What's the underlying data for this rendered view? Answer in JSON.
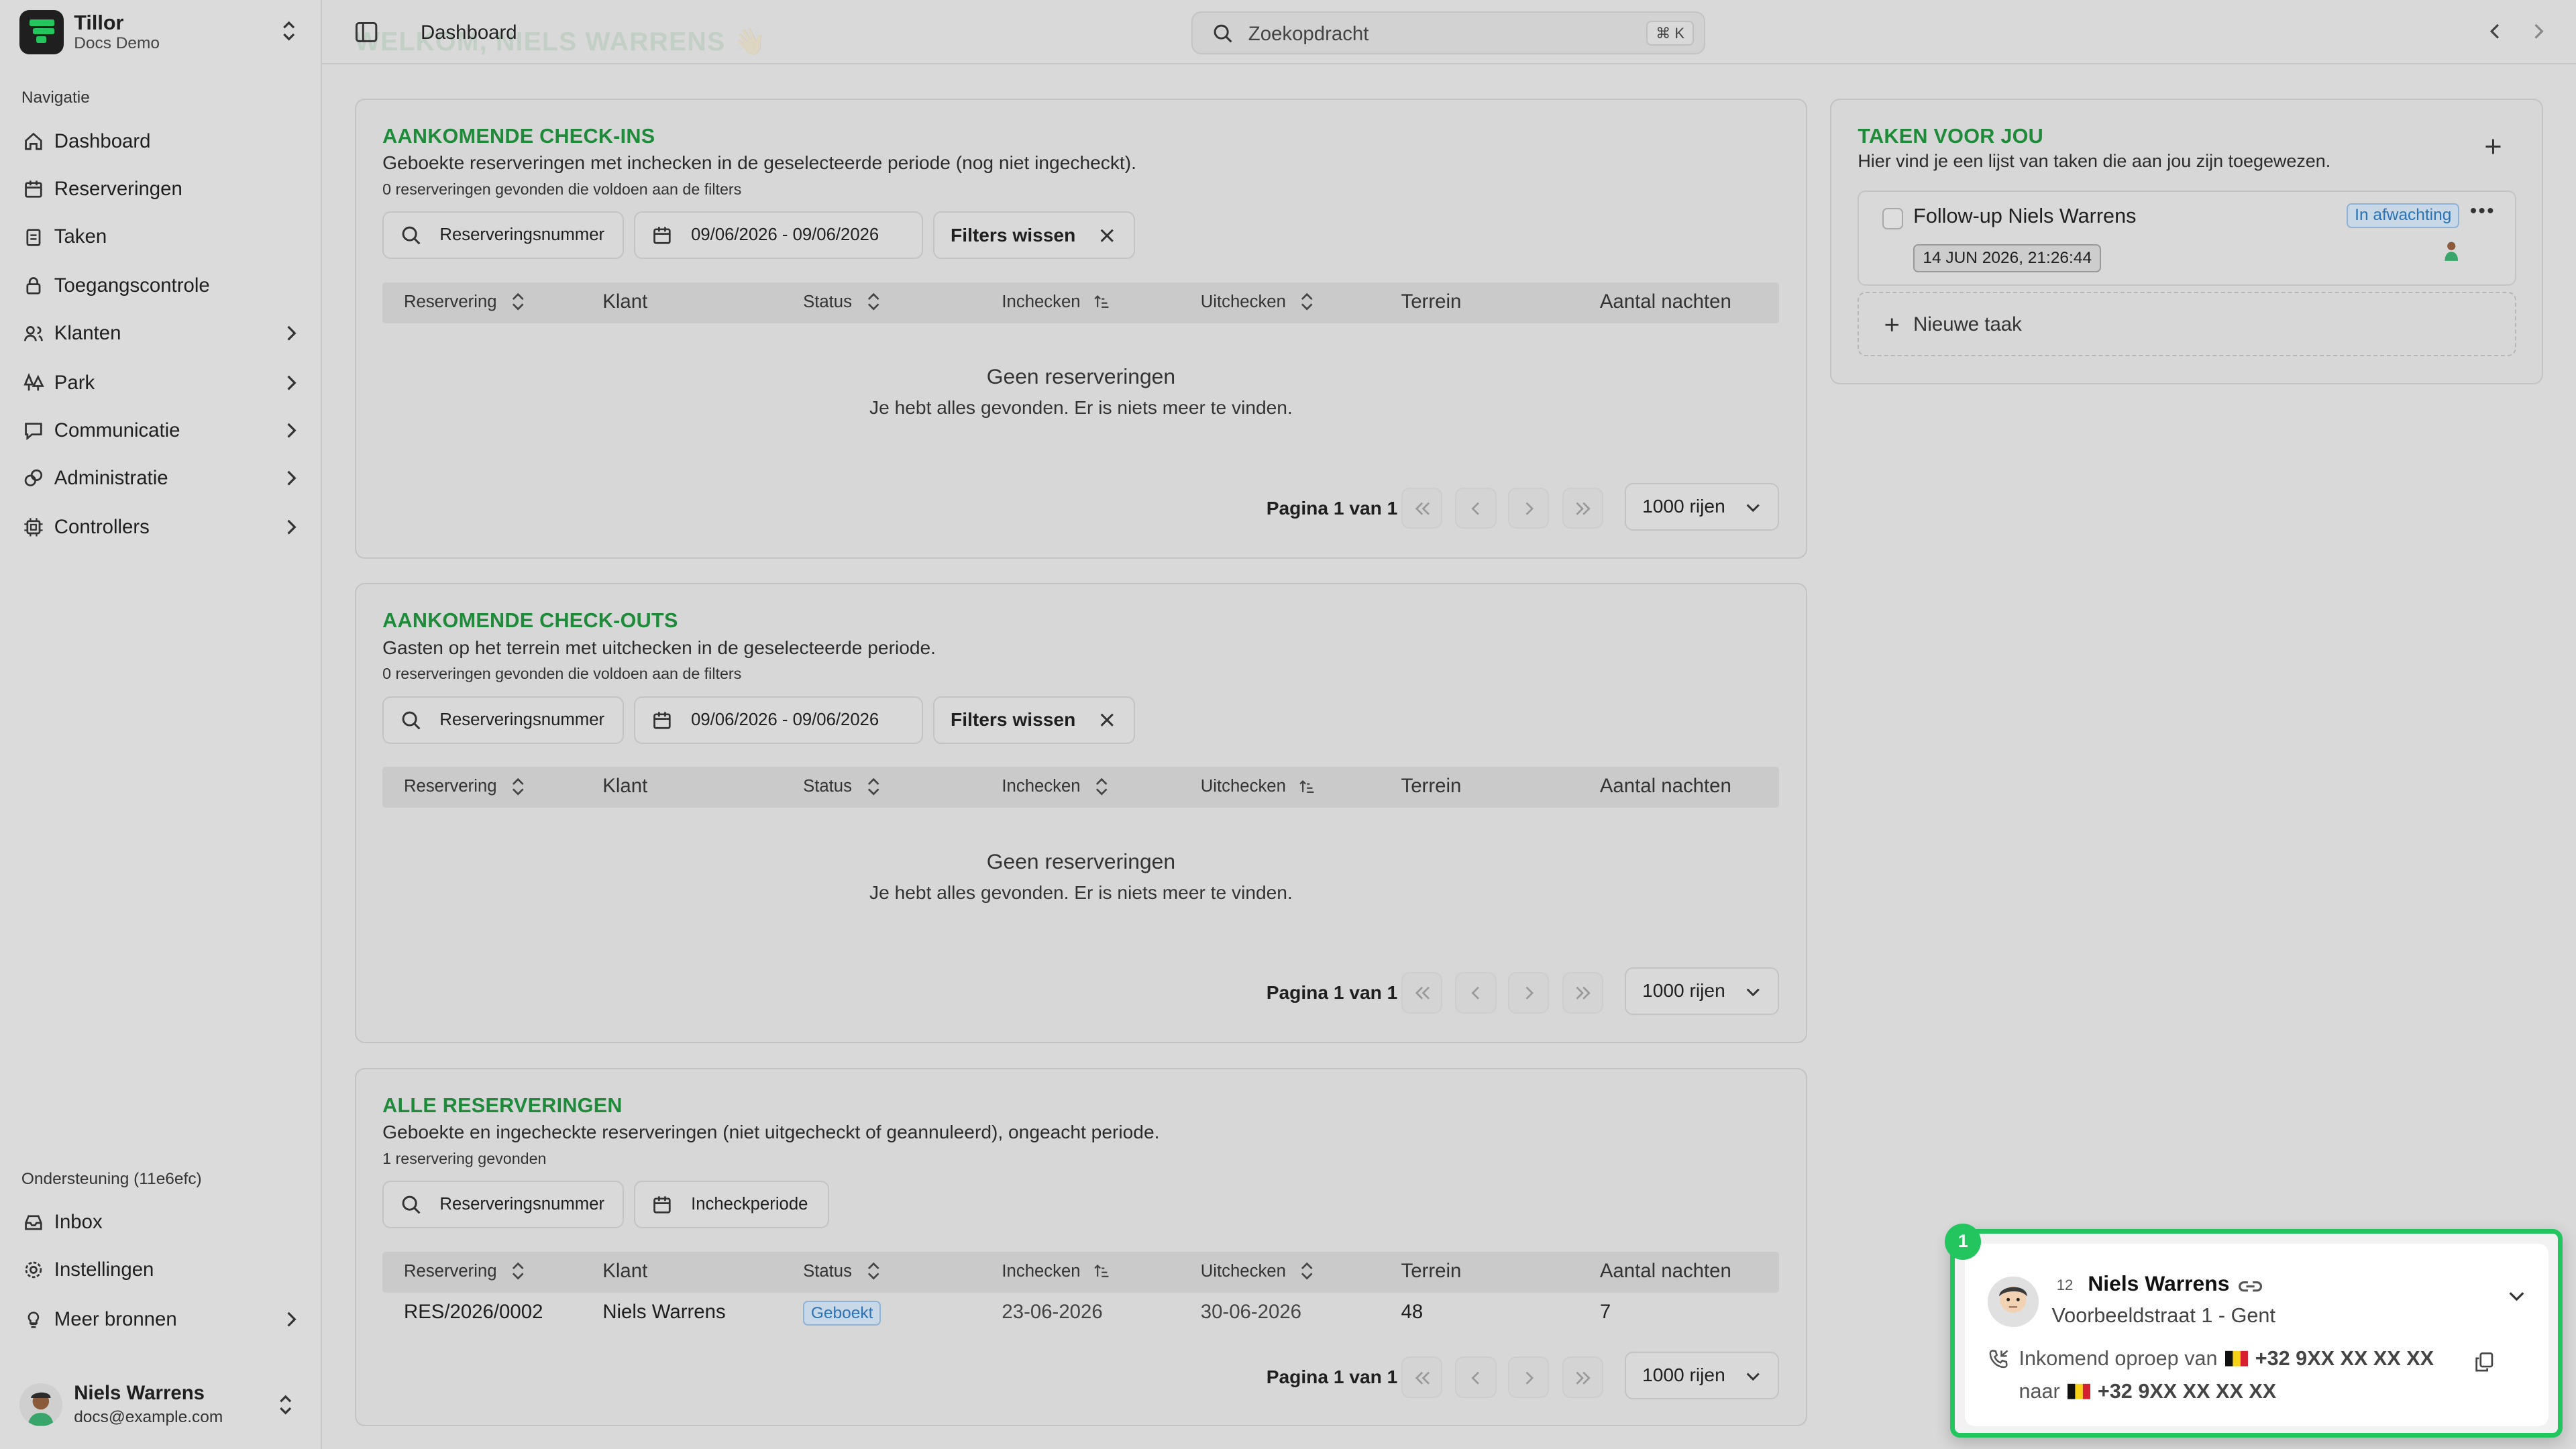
{
  "brand": {
    "name": "Tillor",
    "subtitle": "Docs Demo"
  },
  "sidebar": {
    "section_label": "Navigatie",
    "items": [
      {
        "label": "Dashboard",
        "icon": "house-icon"
      },
      {
        "label": "Reserveringen",
        "icon": "calendar-icon"
      },
      {
        "label": "Taken",
        "icon": "clipboard-icon"
      },
      {
        "label": "Toegangscontrole",
        "icon": "lock-icon"
      },
      {
        "label": "Klanten",
        "icon": "users-icon"
      },
      {
        "label": "Park",
        "icon": "trees-icon"
      },
      {
        "label": "Communicatie",
        "icon": "message-icon"
      },
      {
        "label": "Administratie",
        "icon": "coins-icon"
      },
      {
        "label": "Controllers",
        "icon": "cpu-icon"
      }
    ],
    "support_label": "Ondersteuning (11e6efc)",
    "support_items": [
      {
        "label": "Inbox",
        "icon": "inbox-icon"
      },
      {
        "label": "Instellingen",
        "icon": "gear-icon"
      },
      {
        "label": "Meer bronnen",
        "icon": "lightbulb-icon"
      }
    ],
    "user": {
      "name": "Niels Warrens",
      "email": "docs@example.com"
    }
  },
  "topbar": {
    "breadcrumb": "Dashboard",
    "ghost_title": "WELKOM, NIELS WARRENS 👋",
    "search_placeholder": "Zoekopdracht",
    "search_kbd": "⌘ K"
  },
  "checkins": {
    "title": "AANKOMENDE CHECK-INS",
    "description": "Geboekte reserveringen met inchecken in de geselecteerde periode (nog niet ingecheckt).",
    "count": "0 reserveringen gevonden die voldoen aan de filters",
    "search_label": "Reserveringsnummer",
    "date_label": "09/06/2026 - 09/06/2026",
    "clear_label": "Filters wissen",
    "empty_title": "Geen reserveringen",
    "empty_sub": "Je hebt alles gevonden. Er is niets meer te vinden.",
    "pager": "Pagina 1 van 1",
    "rows_label": "1000 rijen"
  },
  "checkouts": {
    "title": "AANKOMENDE CHECK-OUTS",
    "description": "Gasten op het terrein met uitchecken in de geselecteerde periode.",
    "count": "0 reserveringen gevonden die voldoen aan de filters",
    "search_label": "Reserveringsnummer",
    "date_label": "09/06/2026 - 09/06/2026",
    "clear_label": "Filters wissen",
    "empty_title": "Geen reserveringen",
    "empty_sub": "Je hebt alles gevonden. Er is niets meer te vinden.",
    "pager": "Pagina 1 van 1",
    "rows_label": "1000 rijen"
  },
  "all": {
    "title": "ALLE RESERVERINGEN",
    "description": "Geboekte en ingecheckte reserveringen (niet uitgecheckt of geannuleerd), ongeacht periode.",
    "count": "1 reservering gevonden",
    "search_label": "Reserveringsnummer",
    "date_label": "Incheckperiode",
    "pager": "Pagina 1 van 1",
    "rows_label": "1000 rijen",
    "row": {
      "reservering": "RES/2026/0002",
      "klant": "Niels Warrens",
      "status": "Geboekt",
      "inchecken": "23-06-2026",
      "uitchecken": "30-06-2026",
      "terrein": "48",
      "nachten": "7"
    }
  },
  "columns": {
    "reservering": "Reservering",
    "klant": "Klant",
    "status": "Status",
    "inchecken": "Inchecken",
    "uitchecken": "Uitchecken",
    "terrein": "Terrein",
    "nachten": "Aantal nachten"
  },
  "tasks": {
    "title": "TAKEN VOOR JOU",
    "description": "Hier vind je een lijst van taken die aan jou zijn toegewezen.",
    "item": {
      "title": "Follow-up Niels Warrens",
      "status": "In afwachting",
      "date": "14 JUN 2026, 21:26:44"
    },
    "new_label": "Nieuwe taak"
  },
  "call": {
    "badge": "1",
    "count": "12",
    "name": "Niels Warrens",
    "address": "Voorbeeldstraat 1 - Gent",
    "line1_prefix": "Inkomend oproep van",
    "from_number": "+32 9XX XX XX XX",
    "line2_prefix": "naar",
    "to_number": "+32 9XX XX XX XX"
  },
  "colors": {
    "accent_green": "#1e8a3a",
    "badge_blue": "#2a72b5",
    "call_border": "#22c55e"
  }
}
